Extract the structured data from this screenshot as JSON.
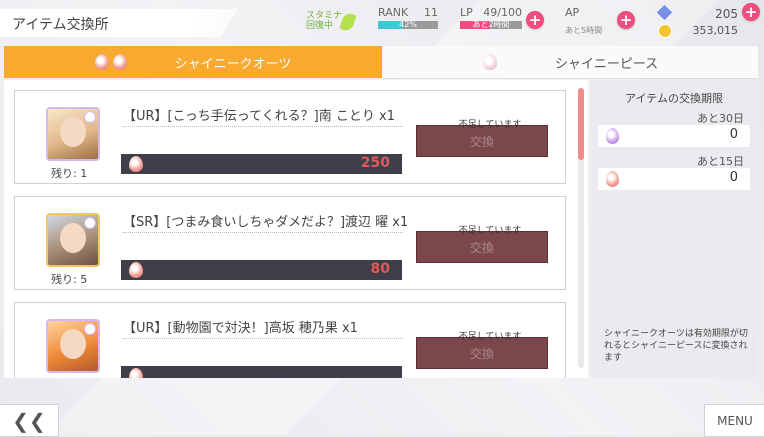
{
  "header": {
    "title": "アイテム交換所",
    "stamina_label": "スタミナ 回復中",
    "rank_label": "RANK",
    "rank_value": "11",
    "rank_progress_text": "42%",
    "rank_progress": 0.42,
    "lp_label": "LP",
    "lp_value": "49/100",
    "lp_sub": "あと2時間",
    "lp_progress": 0.49,
    "ap_label": "AP",
    "ap_sub": "あと5時間",
    "gems": "205",
    "coins": "353,015"
  },
  "tabs": [
    {
      "label": "シャイニークオーツ",
      "active": true
    },
    {
      "label": "シャイニーピース",
      "active": false
    }
  ],
  "items": [
    {
      "name": "【UR】[こっち手伝ってくれる？]南 ことり x1",
      "remain": "残り: 1",
      "cost": "250",
      "status": "不足しています",
      "button": "交換",
      "rarity": "UR"
    },
    {
      "name": "【SR】[つまみ食いしちゃダメだよ？]渡辺 曜 x1",
      "remain": "残り: 5",
      "cost": "80",
      "status": "不足しています",
      "button": "交換",
      "rarity": "SR"
    },
    {
      "name": "【UR】[動物園で対決！]高坂 穂乃果 x1",
      "remain": "",
      "cost": "",
      "status": "不足しています",
      "button": "交換",
      "rarity": "UR"
    }
  ],
  "side": {
    "title": "アイテムの交換期限",
    "entries": [
      {
        "label": "あと30日",
        "value": "0"
      },
      {
        "label": "あと15日",
        "value": "0"
      }
    ],
    "note": "シャイニークオーツは有効期限が切れるとシャイニーピースに変換されます"
  },
  "footer": {
    "back": "❮❮",
    "menu": "MENU"
  },
  "colors": {
    "tab_active": "#f7a930",
    "exchange_disabled": "#7c474b",
    "plus_button": "#ee4d7f",
    "rank_bar": "#3ec9d6",
    "lp_bar": "#ee4d7f"
  }
}
